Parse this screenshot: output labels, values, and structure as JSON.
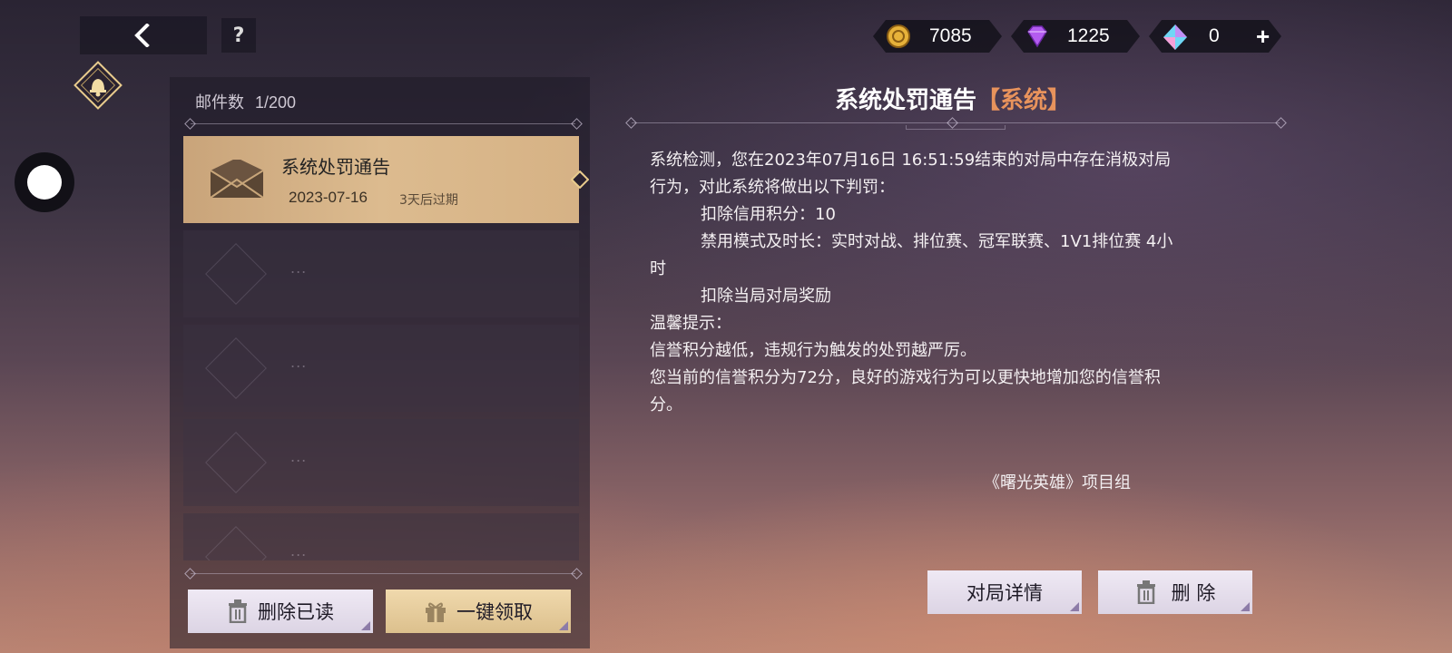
{
  "topbar": {
    "help_label": "?",
    "currencies": [
      {
        "icon": "gold-coin-icon",
        "value": "7085"
      },
      {
        "icon": "purple-diamond-icon",
        "value": "1225"
      },
      {
        "icon": "blue-crystal-icon",
        "value": "0"
      }
    ],
    "add_label": "+"
  },
  "mailbox": {
    "count_label": "邮件数",
    "count_value": "1/200",
    "selected_mail": {
      "title": "系统处罚通告",
      "date": "2023-07-16",
      "expire": "3天后过期"
    },
    "empty_placeholder": "...",
    "delete_read_label": "删除已读",
    "claim_all_label": "一键领取"
  },
  "detail": {
    "title": "系统处罚通告",
    "tag": "【系统】",
    "body": {
      "line1": "系统检测，您在2023年07月16日 16:51:59结束的对局中存在消极对局",
      "line2": "行为，对此系统将做出以下判罚：",
      "line3": "扣除信用积分：10",
      "line4": "禁用模式及时长：实时对战、排位赛、冠军联赛、1V1排位赛 4小",
      "line5": "时",
      "line6": "扣除当局对局奖励",
      "line7": "温馨提示：",
      "line8": "信誉积分越低，违规行为触发的处罚越严厉。",
      "line9": "您当前的信誉积分为72分，良好的游戏行为可以更快地增加您的信誉积",
      "line10": "分。"
    },
    "signature": "《曙光英雄》项目组",
    "match_detail_label": "对局详情",
    "delete_label": "删 除"
  },
  "colors": {
    "tag_orange": "#e8935c",
    "mail_selected_gold": "#d6b285",
    "button_light": "#e6dfec",
    "button_gold": "#e6cd9c"
  }
}
